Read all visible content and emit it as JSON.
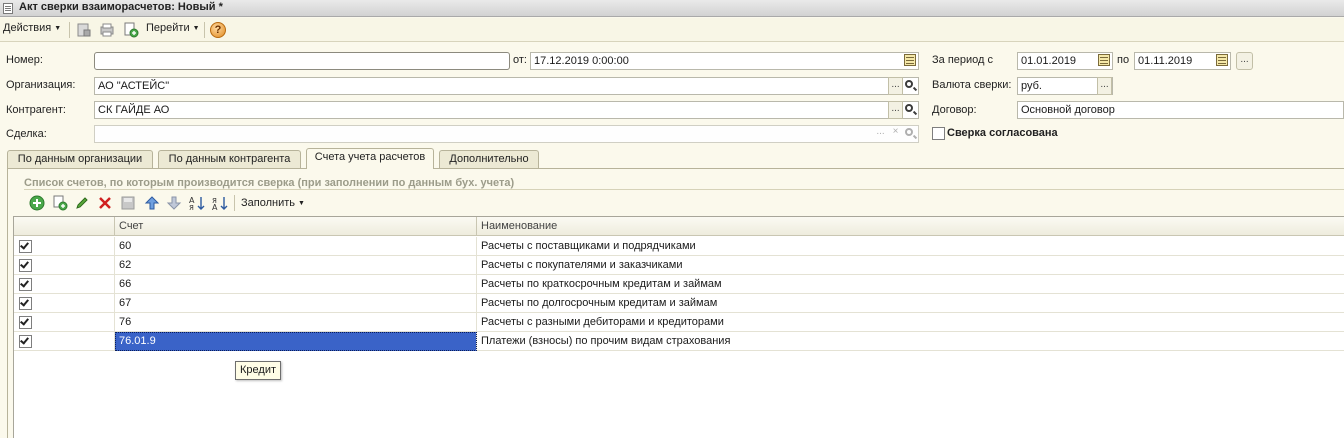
{
  "window": {
    "title": "Акт сверки взаиморасчетов: Новый *"
  },
  "commandbar": {
    "actions_label": "Действия",
    "goto_label": "Перейти",
    "help_glyph": "?"
  },
  "form": {
    "number": {
      "label": "Номер:",
      "value": ""
    },
    "date": {
      "label": "от:",
      "value": "17.12.2019  0:00:00"
    },
    "period": {
      "label": "За период с",
      "from": "01.01.2019",
      "to_label": "по",
      "to": "01.11.2019",
      "more_button": "..."
    },
    "organization": {
      "label": "Организация:",
      "value": "АО \"АСТЕЙС\""
    },
    "currency": {
      "label": "Валюта сверки:",
      "value": "руб."
    },
    "counterparty": {
      "label": "Контрагент:",
      "value": "СК ГАЙДЕ АО"
    },
    "contract": {
      "label": "Договор:",
      "value": "Основной договор"
    },
    "deal": {
      "label": "Сделка:",
      "value": ""
    },
    "agreed": {
      "label": "Сверка согласована",
      "checked": false
    },
    "select_button": "...",
    "clear_button": "×"
  },
  "tabs": [
    {
      "label": "По данным организации",
      "active": false
    },
    {
      "label": "По данным контрагента",
      "active": false
    },
    {
      "label": "Счета учета расчетов",
      "active": true
    },
    {
      "label": "Дополнительно",
      "active": false
    }
  ],
  "accounts": {
    "caption": "Список счетов, по которым производится сверка (при заполнении по данным бух. учета)",
    "fill_label": "Заполнить",
    "columns": [
      "",
      "Счет",
      "Наименование"
    ],
    "rows": [
      {
        "checked": true,
        "account": "60",
        "name": "Расчеты с поставщиками и подрядчиками"
      },
      {
        "checked": true,
        "account": "62",
        "name": "Расчеты с покупателями и заказчиками"
      },
      {
        "checked": true,
        "account": "66",
        "name": "Расчеты по краткосрочным кредитам и займам"
      },
      {
        "checked": true,
        "account": "67",
        "name": "Расчеты по долгосрочным кредитам и займам"
      },
      {
        "checked": true,
        "account": "76",
        "name": "Расчеты с разными дебиторами и кредиторами"
      },
      {
        "checked": true,
        "account": "76.01.9",
        "name": "Платежи (взносы) по прочим видам страхования",
        "selected": true
      }
    ],
    "tooltip": "Кредит"
  },
  "colors": {
    "background": "#fbf9ec",
    "selection": "#3a63c8",
    "caption_gray": "#9c9c8a"
  }
}
